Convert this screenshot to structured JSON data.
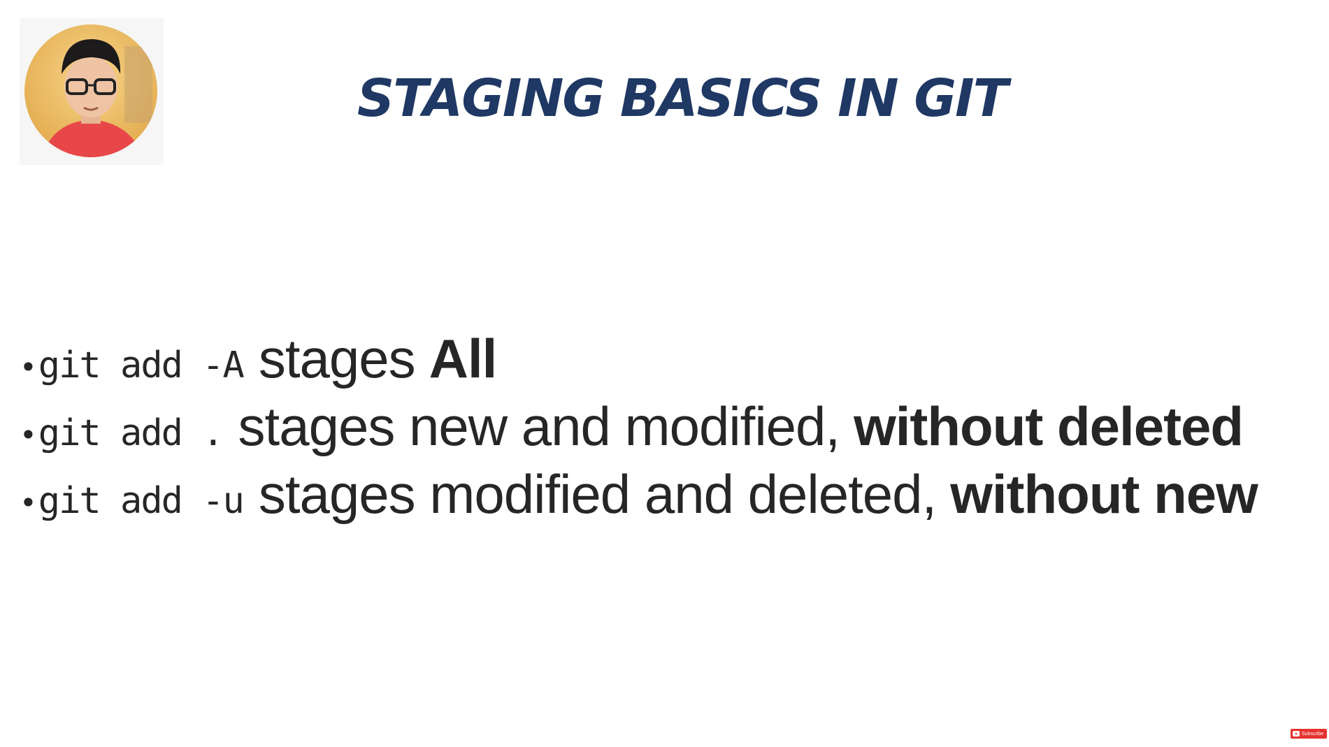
{
  "slide": {
    "title": "STAGING BASICS IN GIT",
    "bullets": [
      {
        "command": "git add -A",
        "description": "stages",
        "emphasis": "All"
      },
      {
        "command": "git add .",
        "description": "stages new and modified,",
        "emphasis": "without deleted"
      },
      {
        "command": "git add -u",
        "description": "stages modified and deleted,",
        "emphasis": "without new"
      }
    ],
    "bullet_glyph": "•"
  },
  "subscribe_badge": {
    "label": "Subscribe",
    "icon": "youtube-play-icon"
  },
  "colors": {
    "title": "#1f3864",
    "body_text": "#262626",
    "background": "#ffffff",
    "badge": "#e5322d"
  }
}
